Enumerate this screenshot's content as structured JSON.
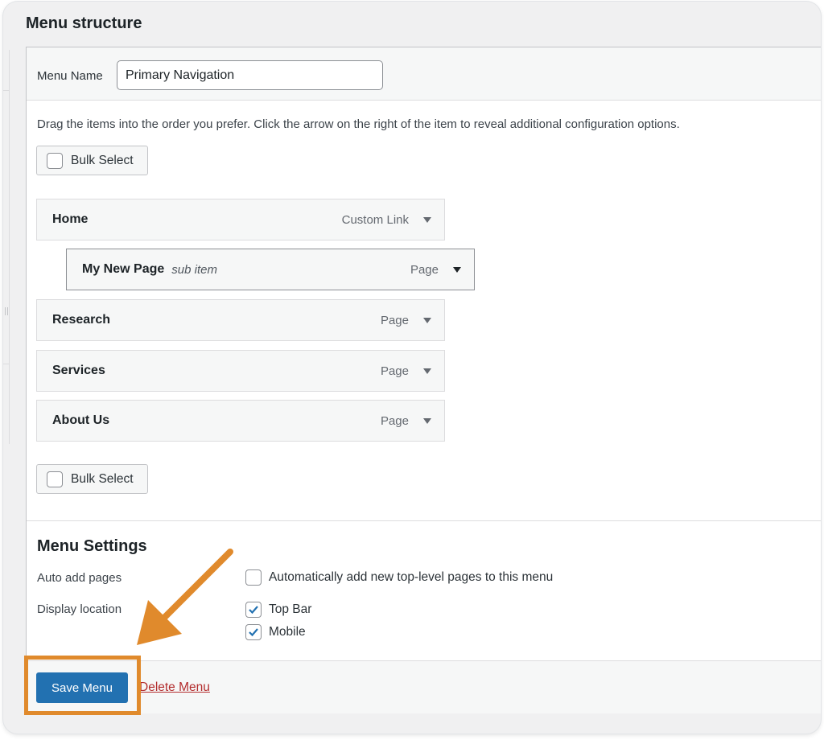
{
  "heading": "Menu structure",
  "menu_name": {
    "label": "Menu Name",
    "value": "Primary Navigation"
  },
  "instructions": "Drag the items into the order you prefer. Click the arrow on the right of the item to reveal additional configuration options.",
  "bulk_select_label": "Bulk Select",
  "menu_items": [
    {
      "title": "Home",
      "sub": "",
      "type": "Custom Link"
    },
    {
      "title": "My New Page",
      "sub": "sub item",
      "type": "Page"
    },
    {
      "title": "Research",
      "sub": "",
      "type": "Page"
    },
    {
      "title": "Services",
      "sub": "",
      "type": "Page"
    },
    {
      "title": "About Us",
      "sub": "",
      "type": "Page"
    }
  ],
  "settings": {
    "title": "Menu Settings",
    "auto_add": {
      "label": "Auto add pages",
      "option": "Automatically add new top-level pages to this menu",
      "checked": false
    },
    "display_location": {
      "label": "Display location",
      "options": [
        {
          "label": "Top Bar",
          "checked": true
        },
        {
          "label": "Mobile",
          "checked": true
        }
      ]
    }
  },
  "footer": {
    "save_label": "Save Menu",
    "delete_label": "Delete Menu"
  },
  "colors": {
    "primary": "#2271b1",
    "delete": "#b32d2e",
    "highlight": "#e08a2c"
  }
}
